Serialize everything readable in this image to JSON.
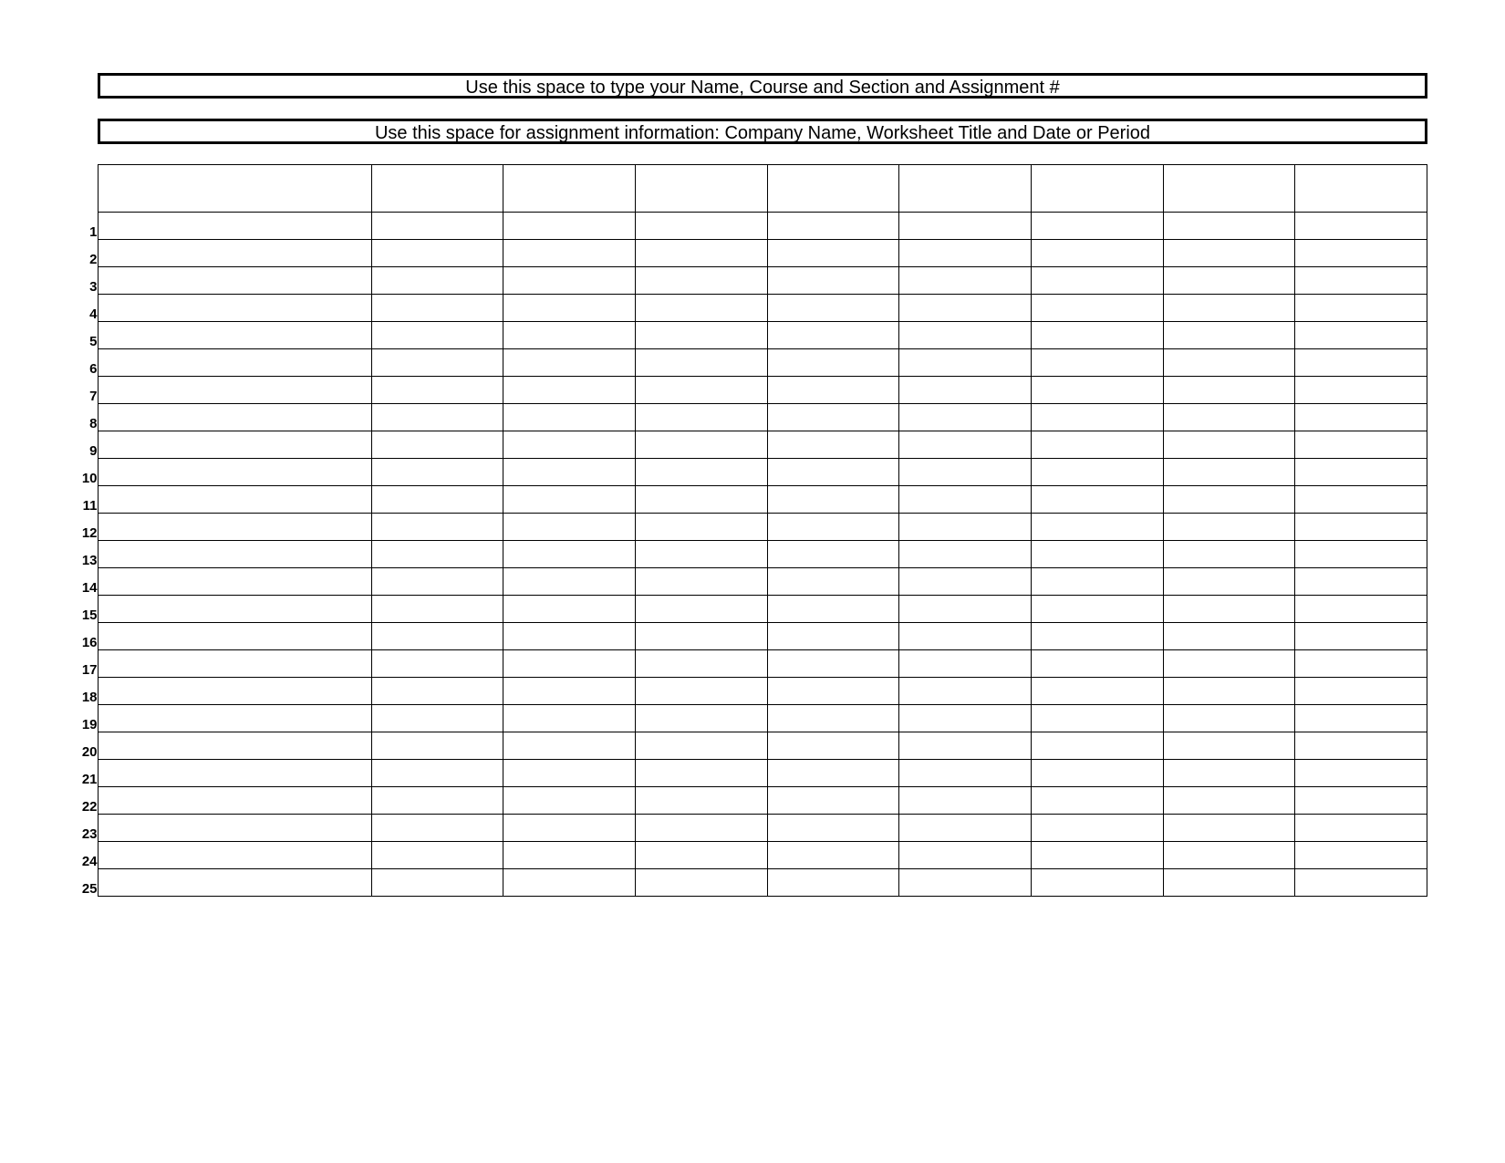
{
  "header": {
    "line1": "Use this space to type your Name, Course and Section and Assignment #",
    "line2": "Use this space for assignment information: Company Name, Worksheet Title and Date or Period"
  },
  "grid": {
    "row_count": 25,
    "data_columns": 9,
    "row_labels": [
      "1",
      "2",
      "3",
      "4",
      "5",
      "6",
      "7",
      "8",
      "9",
      "10",
      "11",
      "12",
      "13",
      "14",
      "15",
      "16",
      "17",
      "18",
      "19",
      "20",
      "21",
      "22",
      "23",
      "24",
      "25"
    ]
  }
}
